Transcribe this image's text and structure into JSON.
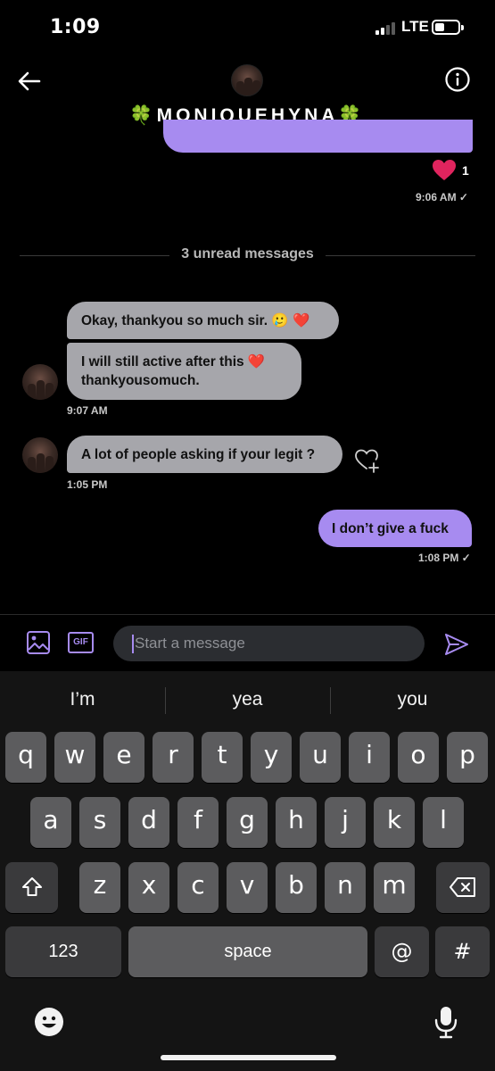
{
  "status_bar": {
    "time": "1:09",
    "network": "LTE"
  },
  "header": {
    "contact_name": "🍀MONIQUEHYNA🍀"
  },
  "messages": {
    "top_reaction_count": "1",
    "top_time": "9:06 AM ✓",
    "unread_divider": "3 unread messages",
    "incoming_1": "Okay, thankyou so much sir. 🥲 ❤️",
    "incoming_2": "I will still active after this ❤️ thankyousomuch.",
    "incoming_2_time": "9:07 AM",
    "incoming_3": "A lot of people asking if your legit ?",
    "incoming_3_time": "1:05 PM",
    "outgoing_1": "I don’t give a fuck",
    "outgoing_1_time": "1:08 PM ✓"
  },
  "composer": {
    "placeholder": "Start a message",
    "gif_label": "GIF"
  },
  "keyboard": {
    "suggestions": [
      "I’m",
      "yea",
      "you"
    ],
    "row1": [
      "q",
      "w",
      "e",
      "r",
      "t",
      "y",
      "u",
      "i",
      "o",
      "p"
    ],
    "row2": [
      "a",
      "s",
      "d",
      "f",
      "g",
      "h",
      "j",
      "k",
      "l"
    ],
    "row3": [
      "z",
      "x",
      "c",
      "v",
      "b",
      "n",
      "m"
    ],
    "numbers_label": "123",
    "space_label": "space",
    "at_label": "@",
    "hash_label": "#"
  },
  "colors": {
    "accent": "#a78bf0",
    "incoming_bubble": "#a6a6ab",
    "background": "#000000",
    "heart": "#e0245e"
  }
}
